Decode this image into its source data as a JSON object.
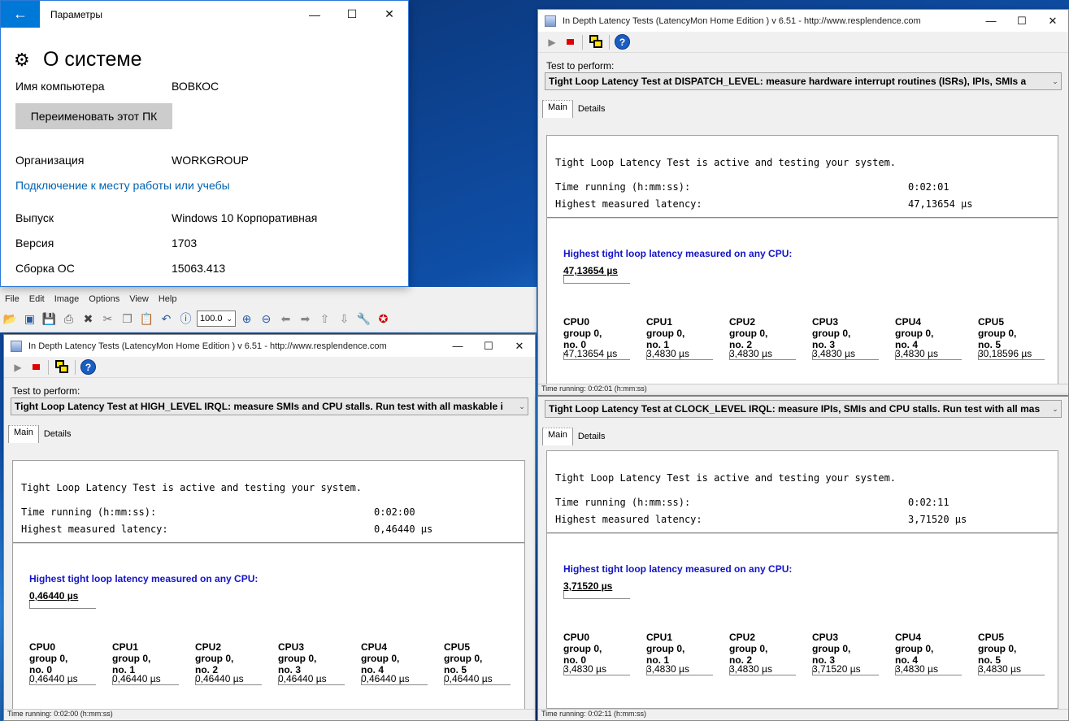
{
  "settings": {
    "title": "Параметры",
    "heading": "О системе",
    "rows": [
      {
        "label": "Имя компьютера",
        "value": "ВОВКОС"
      },
      {
        "label": "Организация",
        "value": "WORKGROUP"
      },
      {
        "label": "Выпуск",
        "value": "Windows 10 Корпоративная"
      },
      {
        "label": "Версия",
        "value": "1703"
      },
      {
        "label": "Сборка ОС",
        "value": "15063.413"
      }
    ],
    "rename_button": "Переименовать этот ПК",
    "work_link": "Подключение к месту работы или учебы"
  },
  "viewer": {
    "menu": [
      "File",
      "Edit",
      "Image",
      "Options",
      "View",
      "Help"
    ],
    "zoom": "100.0"
  },
  "latencymon": {
    "title": "In Depth Latency Tests  (LatencyMon Home Edition )  v 6.51 - http://www.resplendence.com",
    "test_label": "Test to perform:",
    "tab_main": "Main",
    "tab_details": "Details",
    "active_text": "Tight Loop Latency Test is active and testing your system.",
    "time_label": "Time running (h:mm:ss):",
    "latency_label": "Highest measured latency:",
    "highest_cpu_label": "Highest tight loop latency measured on any CPU:",
    "cpu_group": "group 0,",
    "windows": [
      {
        "test": "Tight Loop Latency Test at DISPATCH_LEVEL:  measure hardware interrupt routines (ISRs), IPIs, SMIs a",
        "time": "0:02:01",
        "latency": "47,13654 µs",
        "highest": "47,13654 µs",
        "status": "Time running: 0:02:01  (h:mm:ss)",
        "cpus": [
          {
            "name": "CPU0",
            "no": "no. 0",
            "value": "47,13654 µs"
          },
          {
            "name": "CPU1",
            "no": "no. 1",
            "value": "3,4830 µs"
          },
          {
            "name": "CPU2",
            "no": "no. 2",
            "value": "3,4830 µs"
          },
          {
            "name": "CPU3",
            "no": "no. 3",
            "value": "3,4830 µs"
          },
          {
            "name": "CPU4",
            "no": "no. 4",
            "value": "3,4830 µs"
          },
          {
            "name": "CPU5",
            "no": "no. 5",
            "value": "30,18596 µs"
          }
        ]
      },
      {
        "test": "Tight Loop Latency Test at HIGH_LEVEL IRQL:  measure SMIs and CPU stalls. Run test with all maskable i",
        "time": "0:02:00",
        "latency": "0,46440 µs",
        "highest": "0,46440 µs",
        "status": "Time running: 0:02:00  (h:mm:ss)",
        "cpus": [
          {
            "name": "CPU0",
            "no": "no. 0",
            "value": "0,46440 µs"
          },
          {
            "name": "CPU1",
            "no": "no. 1",
            "value": "0,46440 µs"
          },
          {
            "name": "CPU2",
            "no": "no. 2",
            "value": "0,46440 µs"
          },
          {
            "name": "CPU3",
            "no": "no. 3",
            "value": "0,46440 µs"
          },
          {
            "name": "CPU4",
            "no": "no. 4",
            "value": "0,46440 µs"
          },
          {
            "name": "CPU5",
            "no": "no. 5",
            "value": "0,46440 µs"
          }
        ]
      },
      {
        "test": "Tight Loop Latency Test at CLOCK_LEVEL IRQL: measure IPIs, SMIs and CPU stalls. Run test with all mas",
        "time": "0:02:11",
        "latency": "3,71520 µs",
        "highest": "3,71520 µs",
        "status": "Time running: 0:02:11  (h:mm:ss)",
        "cpus": [
          {
            "name": "CPU0",
            "no": "no. 0",
            "value": "3,4830 µs"
          },
          {
            "name": "CPU1",
            "no": "no. 1",
            "value": "3,4830 µs"
          },
          {
            "name": "CPU2",
            "no": "no. 2",
            "value": "3,4830 µs"
          },
          {
            "name": "CPU3",
            "no": "no. 3",
            "value": "3,71520 µs"
          },
          {
            "name": "CPU4",
            "no": "no. 4",
            "value": "3,4830 µs"
          },
          {
            "name": "CPU5",
            "no": "no. 5",
            "value": "3,4830 µs"
          }
        ]
      }
    ]
  }
}
